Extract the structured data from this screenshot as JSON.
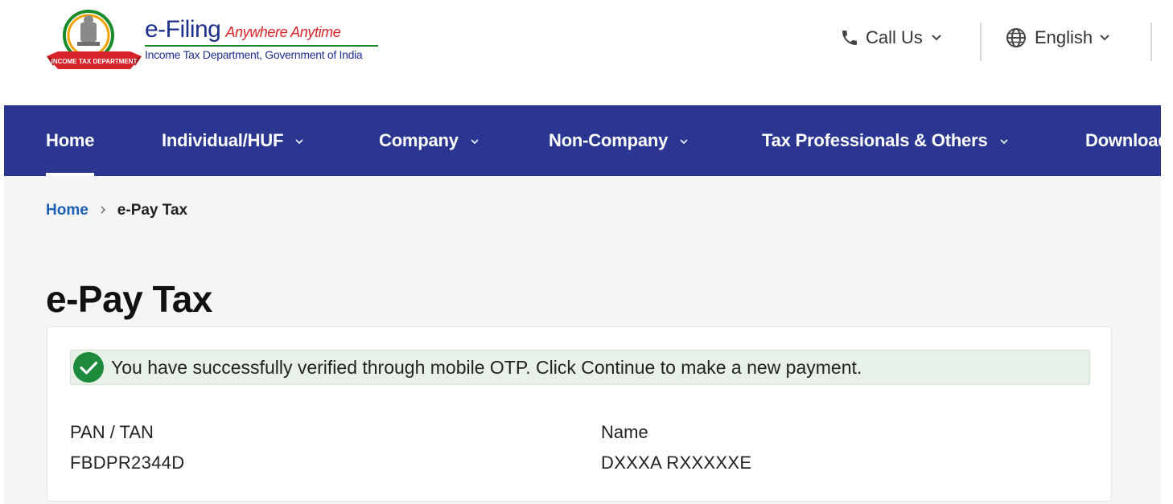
{
  "header": {
    "brand_name": "e-Filing",
    "brand_tagline": "Anywhere Anytime",
    "brand_subtitle": "Income Tax Department, Government of India",
    "logo_ribbon_text": "INCOME TAX DEPARTMENT",
    "call_us_label": "Call Us",
    "language_label": "English"
  },
  "nav": {
    "items": [
      {
        "label": "Home",
        "active": true
      },
      {
        "label": "Individual/HUF"
      },
      {
        "label": "Company"
      },
      {
        "label": "Non-Company"
      },
      {
        "label": "Tax Professionals & Others"
      },
      {
        "label": "Downloads"
      }
    ]
  },
  "breadcrumb": {
    "home": "Home",
    "current": "e-Pay Tax"
  },
  "page": {
    "title": "e-Pay Tax",
    "alert": "You have successfully verified through mobile OTP. Click Continue to make a new payment.",
    "pan_label": "PAN / TAN",
    "pan_value": "FBDPR2344D",
    "name_label": "Name",
    "name_value": "DXXXA RXXXXXE"
  },
  "colors": {
    "nav_bg": "#2b3691",
    "link": "#1d5fb4",
    "success": "#1e8a3c",
    "brand_red": "#d9232a",
    "brand_blue": "#1f2f8c"
  },
  "icons": [
    "emblem-logo",
    "phone-icon",
    "globe-icon",
    "chevron-down-icon",
    "check-circle-icon",
    "chevron-right-icon"
  ]
}
